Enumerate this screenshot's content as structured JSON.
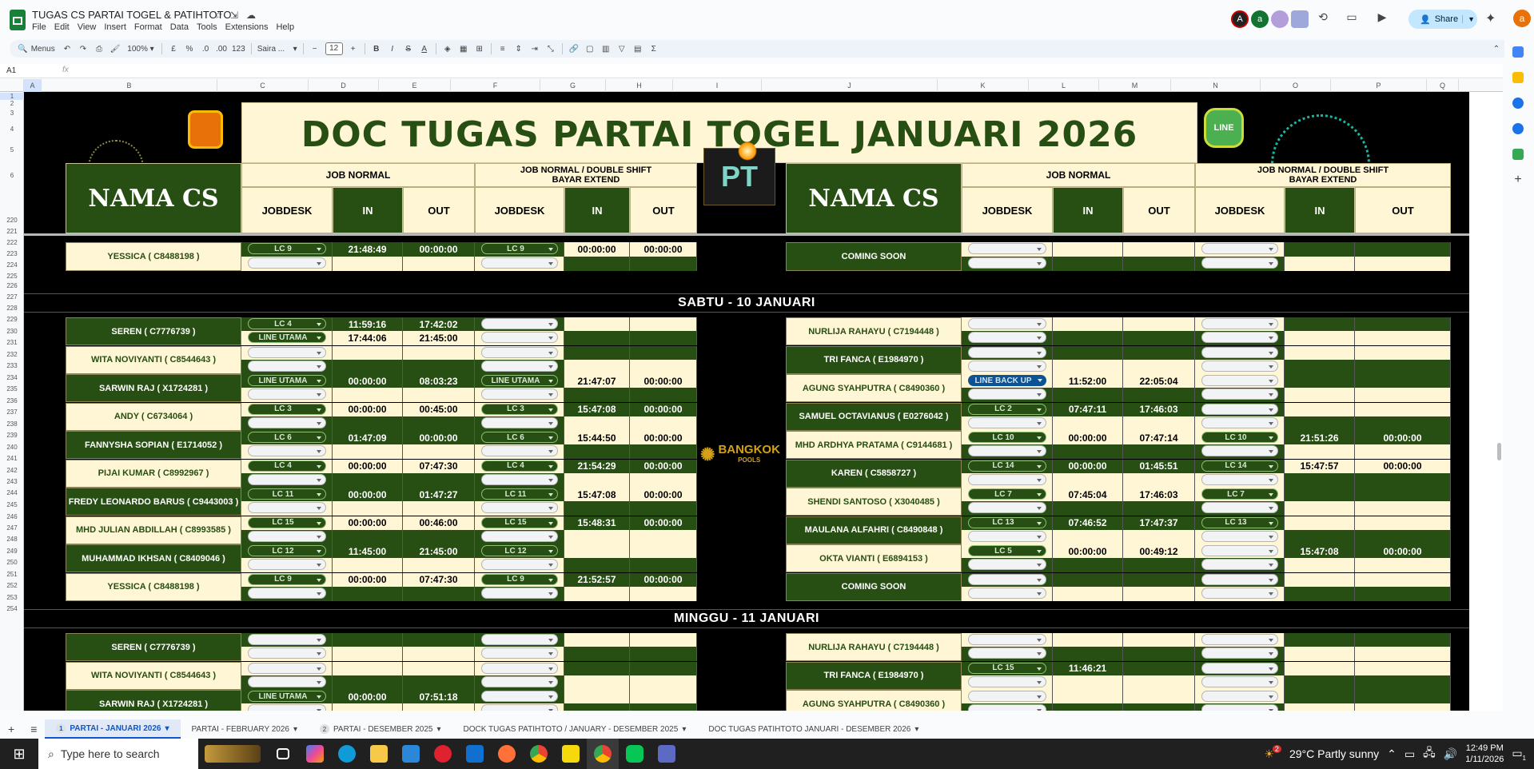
{
  "doc": {
    "title": "TUGAS CS PARTAI TOGEL & PATIHTOTO",
    "menu": [
      "File",
      "Edit",
      "View",
      "Insert",
      "Format",
      "Data",
      "Tools",
      "Extensions",
      "Help"
    ]
  },
  "top": {
    "share_label": "Share",
    "user_initial": "a",
    "collab_initials": [
      "A",
      "a",
      "",
      ""
    ]
  },
  "toolbar": {
    "menus_label": "Menus",
    "zoom": "100%",
    "currency": "£",
    "percent": "%",
    "dec_down": ".0",
    "dec_up": ".00",
    "number_format": "123",
    "font": "Saira ...",
    "font_size": "12",
    "bold": "B",
    "italic": "I",
    "strike": "S",
    "text_color": "A",
    "sigma": "Σ"
  },
  "formula": {
    "namebox": "A1",
    "fx": "fx"
  },
  "columns": [
    "A",
    "B",
    "C",
    "D",
    "E",
    "F",
    "G",
    "H",
    "I",
    "J",
    "K",
    "L",
    "M",
    "N",
    "O",
    "P",
    "Q"
  ],
  "rows": [
    "1",
    "2",
    "3",
    "4",
    "5",
    "6",
    "220",
    "221",
    "222",
    "223",
    "224",
    "225",
    "226",
    "227",
    "228",
    "229",
    "230",
    "231",
    "232",
    "233",
    "234",
    "235",
    "236",
    "237",
    "238",
    "239",
    "240",
    "241",
    "242",
    "243",
    "244",
    "245",
    "246",
    "247",
    "248",
    "249",
    "250",
    "251",
    "252",
    "253",
    "254"
  ],
  "banner": {
    "title": "DOC TUGAS PARTAI TOGEL JANUARI 2026",
    "center_logo": "PT",
    "mid_logo": "BANGKOK",
    "mid_logo_sub": "POOLS",
    "line_label": "LINE"
  },
  "headers": {
    "nama_cs": "NAMA CS",
    "job_normal": "JOB NORMAL",
    "job_double": "JOB NORMAL / DOUBLE SHIFT",
    "bayar_extend": "BAYAR EXTEND",
    "jobdesk": "JOBDESK",
    "in": "IN",
    "out": "OUT"
  },
  "top_block": {
    "left": {
      "name": "YESSICA ( C8488198 )",
      "r1": {
        "job1": "LC 9",
        "in1": "21:48:49",
        "out1": "00:00:00",
        "job2": "LC 9",
        "in2": "00:00:00",
        "out2": "00:00:00"
      }
    },
    "right": {
      "name": "COMING SOON"
    }
  },
  "days": [
    {
      "label": "SABTU - 10 JANUARI",
      "left": [
        {
          "name": "SEREN ( C7776739 )",
          "a": {
            "job1": "LC 4",
            "in1": "11:59:16",
            "out1": "17:42:02",
            "job2": "",
            "in2": "",
            "out2": ""
          },
          "b": {
            "job1": "LINE UTAMA",
            "in1": "17:44:06",
            "out1": "21:45:00",
            "job2": "",
            "in2": "",
            "out2": ""
          }
        },
        {
          "name": "WITA NOVIYANTI  ( C8544643 )",
          "a": {
            "job1": "",
            "in1": "",
            "out1": "",
            "job2": "",
            "in2": "",
            "out2": ""
          },
          "b": {
            "job1": "",
            "in1": "",
            "out1": "",
            "job2": "",
            "in2": "",
            "out2": ""
          }
        },
        {
          "name": "SARWIN RAJ  ( X1724281 )",
          "a": {
            "job1": "LINE UTAMA",
            "in1": "00:00:00",
            "out1": "08:03:23",
            "job2": "LINE UTAMA",
            "in2": "21:47:07",
            "out2": "00:00:00"
          },
          "b": {
            "job1": "",
            "in1": "",
            "out1": "",
            "job2": "",
            "in2": "",
            "out2": ""
          }
        },
        {
          "name": "ANDY ( C6734064 )",
          "a": {
            "job1": "LC 3",
            "in1": "00:00:00",
            "out1": "00:45:00",
            "job2": "LC 3",
            "in2": "15:47:08",
            "out2": "00:00:00"
          },
          "b": {
            "job1": "",
            "in1": "",
            "out1": "",
            "job2": "",
            "in2": "",
            "out2": ""
          }
        },
        {
          "name": "FANNYSHA SOPIAN ( E1714052 )",
          "a": {
            "job1": "LC 6",
            "in1": "01:47:09",
            "out1": "00:00:00",
            "job2": "LC 6",
            "in2": "15:44:50",
            "out2": "00:00:00"
          },
          "b": {
            "job1": "",
            "in1": "",
            "out1": "",
            "job2": "",
            "in2": "",
            "out2": ""
          }
        },
        {
          "name": "PIJAI KUMAR  ( C8992967 )",
          "a": {
            "job1": "LC 4",
            "in1": "00:00:00",
            "out1": "07:47:30",
            "job2": "LC 4",
            "in2": "21:54:29",
            "out2": "00:00:00"
          },
          "b": {
            "job1": "",
            "in1": "",
            "out1": "",
            "job2": "",
            "in2": "",
            "out2": ""
          }
        },
        {
          "name": "FREDY LEONARDO BARUS ( C9443003 )",
          "a": {
            "job1": "LC 11",
            "in1": "00:00:00",
            "out1": "01:47:27",
            "job2": "LC 11",
            "in2": "15:47:08",
            "out2": "00:00:00"
          },
          "b": {
            "job1": "",
            "in1": "",
            "out1": "",
            "job2": "",
            "in2": "",
            "out2": ""
          }
        },
        {
          "name": "MHD JULIAN ABDILLAH ( C8993585 )",
          "a": {
            "job1": "LC 15",
            "in1": "00:00:00",
            "out1": "00:46:00",
            "job2": "LC 15",
            "in2": "15:48:31",
            "out2": "00:00:00"
          },
          "b": {
            "job1": "",
            "in1": "",
            "out1": "",
            "job2": "",
            "in2": "",
            "out2": ""
          }
        },
        {
          "name": "MUHAMMAD IKHSAN ( C8409046 )",
          "a": {
            "job1": "LC 12",
            "in1": "11:45:00",
            "out1": "21:45:00",
            "job2": "LC 12",
            "in2": "",
            "out2": ""
          },
          "b": {
            "job1": "",
            "in1": "",
            "out1": "",
            "job2": "",
            "in2": "",
            "out2": ""
          }
        },
        {
          "name": "YESSICA ( C8488198 )",
          "a": {
            "job1": "LC 9",
            "in1": "00:00:00",
            "out1": "07:47:30",
            "job2": "LC 9",
            "in2": "21:52:57",
            "out2": "00:00:00"
          },
          "b": {
            "job1": "",
            "in1": "",
            "out1": "",
            "job2": "",
            "in2": "",
            "out2": ""
          }
        }
      ],
      "right": [
        {
          "name": "NURLIJA RAHAYU  ( C7194448 )",
          "a": {
            "job1": "",
            "in1": "",
            "out1": "",
            "job2": "",
            "in2": "",
            "out2": ""
          }
        },
        {
          "name": "TRI FANCA  ( E1984970 )",
          "a": {
            "job1": "",
            "in1": "",
            "out1": "",
            "job2": "",
            "in2": "",
            "out2": ""
          }
        },
        {
          "name": "AGUNG SYAHPUTRA ( C8490360 )",
          "a": {
            "job1": "LINE BACK UP",
            "in1": "11:52:00",
            "out1": "22:05:04",
            "job2": "",
            "in2": "",
            "out2": ""
          }
        },
        {
          "name": "SAMUEL OCTAVIANUS  ( E0276042 )",
          "a": {
            "job1": "LC 2",
            "in1": "07:47:11",
            "out1": "17:46:03",
            "job2": "",
            "in2": "",
            "out2": ""
          }
        },
        {
          "name": "MHD ARDHYA PRATAMA  ( C9144681 )",
          "a": {
            "job1": "LC 10",
            "in1": "00:00:00",
            "out1": "07:47:14",
            "job2": "LC 10",
            "in2": "21:51:26",
            "out2": "00:00:00"
          }
        },
        {
          "name": "KAREN ( C5858727 )",
          "a": {
            "job1": "LC 14",
            "in1": "00:00:00",
            "out1": "01:45:51",
            "job2": "LC 14",
            "in2": "15:47:57",
            "out2": "00:00:00"
          }
        },
        {
          "name": "SHENDI SANTOSO ( X3040485 )",
          "a": {
            "job1": "LC 7",
            "in1": "07:45:04",
            "out1": "17:46:03",
            "job2": "LC 7",
            "in2": "",
            "out2": ""
          }
        },
        {
          "name": "MAULANA ALFAHRI ( C8490848 )",
          "a": {
            "job1": "LC 13",
            "in1": "07:46:52",
            "out1": "17:47:37",
            "job2": "LC 13",
            "in2": "",
            "out2": ""
          }
        },
        {
          "name": "OKTA VIANTI  ( E6894153 )",
          "a": {
            "job1": "LC 5",
            "in1": "00:00:00",
            "out1": "00:49:12",
            "job2": "",
            "in2": "15:47:08",
            "out2": "00:00:00"
          }
        },
        {
          "name": "COMING SOON",
          "a": {
            "job1": "",
            "in1": "",
            "out1": "",
            "job2": "",
            "in2": "",
            "out2": ""
          }
        }
      ]
    },
    {
      "label": "MINGGU - 11 JANUARI",
      "left": [
        {
          "name": "SEREN ( C7776739 )",
          "a": {
            "job1": "",
            "in1": "",
            "out1": "",
            "job2": "",
            "in2": "",
            "out2": ""
          }
        },
        {
          "name": "WITA NOVIYANTI  ( C8544643 )",
          "a": {
            "job1": "",
            "in1": "",
            "out1": "",
            "job2": "",
            "in2": "",
            "out2": ""
          }
        },
        {
          "name": "SARWIN RAJ  ( X1724281 )",
          "a": {
            "job1": "LINE UTAMA",
            "in1": "00:00:00",
            "out1": "07:51:18",
            "job2": "",
            "in2": "",
            "out2": ""
          }
        }
      ],
      "right": [
        {
          "name": "NURLIJA RAHAYU  ( C7194448 )",
          "a": {
            "job1": "",
            "in1": "",
            "out1": "",
            "job2": "",
            "in2": "",
            "out2": ""
          }
        },
        {
          "name": "TRI FANCA  ( E1984970 )",
          "a": {
            "job1": "LC 15",
            "in1": "11:46:21",
            "out1": "",
            "job2": "",
            "in2": "",
            "out2": ""
          }
        },
        {
          "name": "AGUNG SYAHPUTRA ( C8490360 )",
          "a": {
            "job1": "",
            "in1": "",
            "out1": "",
            "job2": "",
            "in2": "",
            "out2": ""
          }
        }
      ]
    }
  ],
  "tabs": [
    {
      "label": "PARTAI - JANUARI 2026",
      "badge": "1",
      "active": true
    },
    {
      "label": "PARTAI - FEBRUARY 2026",
      "badge": "",
      "active": false
    },
    {
      "label": "PARTAI - DESEMBER 2025",
      "badge": "2",
      "active": false
    },
    {
      "label": "DOCK TUGAS PATIHTOTO / JANUARY - DESEMBER 2025",
      "badge": "",
      "active": false
    },
    {
      "label": "DOC TUGAS PATIHTOTO JANUARI - DESEMBER 2026",
      "badge": "",
      "active": false
    }
  ],
  "taskbar": {
    "search_placeholder": "Type here to search",
    "weather": "29°C  Partly sunny",
    "weather_badge": "2",
    "time": "12:49 PM",
    "date": "1/11/2026",
    "notif": "1"
  },
  "colors": {
    "dark_green": "#274e13",
    "cream": "#fff6d5",
    "accent": "#0b57d0"
  }
}
